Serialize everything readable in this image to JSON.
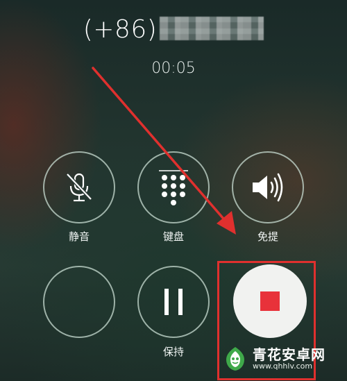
{
  "call": {
    "caller_prefix": "(+86)",
    "timer": "00:05"
  },
  "controls": {
    "mute_label": "静音",
    "keypad_label": "键盘",
    "speaker_label": "免提",
    "hold_label": "保持"
  },
  "annotation": {
    "color": "#e0302e"
  },
  "watermark": {
    "title": "青花安卓网",
    "url": "www.qhhlv.com"
  }
}
